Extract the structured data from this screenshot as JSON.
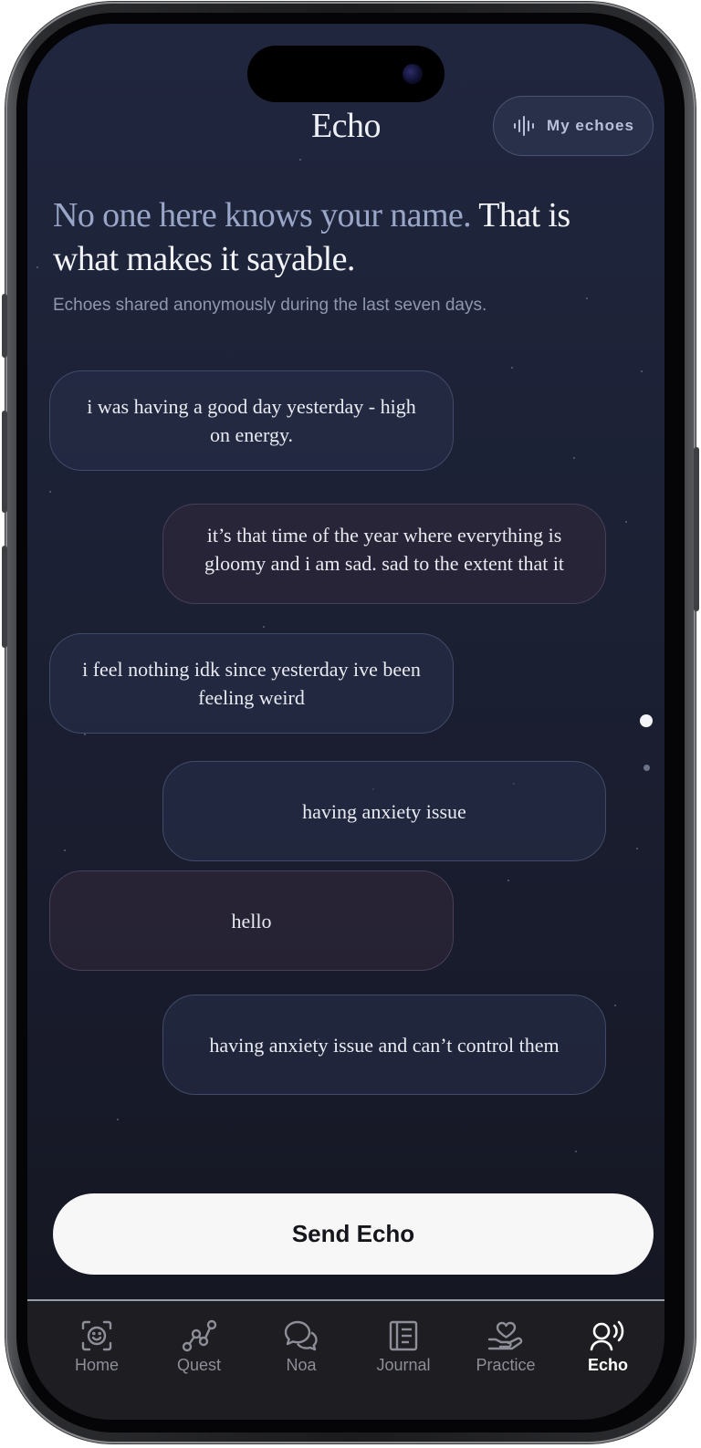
{
  "header": {
    "title": "Echo",
    "my_echoes_label": "My echoes"
  },
  "intro": {
    "heading_muted": "No one here knows your name.",
    "heading_rest": "That is what makes it sayable.",
    "subtext": "Echoes shared anonymously during the last seven days."
  },
  "echoes": [
    {
      "text": "i was having a good day yesterday - high on energy."
    },
    {
      "text": "it’s that time of the year where everything is gloomy and i am sad. sad to the extent that it could affect my everyday routine and work"
    },
    {
      "text": "i feel nothing idk since yesterday ive been feeling weird"
    },
    {
      "text": "having anxiety issue"
    },
    {
      "text": "hello"
    },
    {
      "text": "having anxiety issue and can’t control them"
    }
  ],
  "pager": {
    "pages": 2,
    "current_page": 1
  },
  "send_button_label": "Send Echo",
  "tabs": [
    {
      "label": "Home",
      "icon": "face-scan-icon"
    },
    {
      "label": "Quest",
      "icon": "path-nodes-icon"
    },
    {
      "label": "Noa",
      "icon": "chat-bubbles-icon"
    },
    {
      "label": "Journal",
      "icon": "notebook-icon"
    },
    {
      "label": "Practice",
      "icon": "hand-heart-icon"
    },
    {
      "label": "Echo",
      "icon": "speaking-head-icon"
    }
  ],
  "active_tab": "Echo",
  "colors": {
    "background": "#1c2135",
    "accent_muted": "#9aa6c8",
    "button_bg": "#f7f7f8"
  }
}
